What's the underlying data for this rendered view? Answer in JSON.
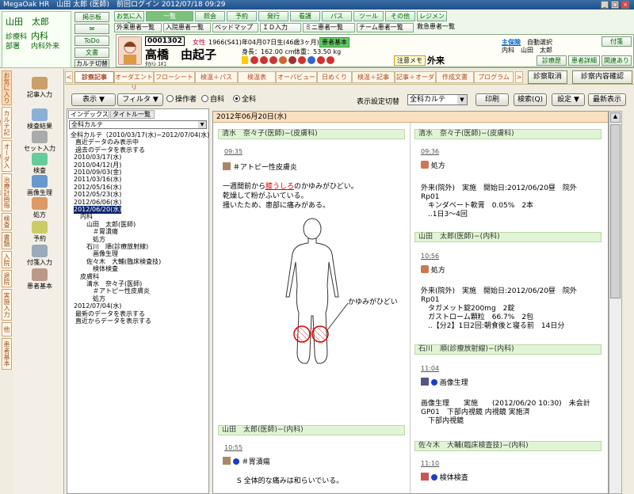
{
  "titlebar": {
    "text": "MegaOak HR　山田 太郎 (医師)　前回ログイン 2012/07/18 09:29",
    "buttons": [
      "_",
      "□",
      "×"
    ]
  },
  "user": {
    "name": "山田　太郎",
    "dept1": "診療科",
    "dept_val": "内科",
    "dept2": "部署",
    "dept2_val": "内科外来"
  },
  "header_buttons": {
    "notice": "掲示板",
    "mail": "✉",
    "todo": "ToDo",
    "doc": "文書",
    "chart_switch": "カルテ切替"
  },
  "main_tabs": [
    "お気に入り",
    "一覧",
    "照会",
    "予約",
    "発行",
    "看護",
    "パス",
    "ツール",
    "その他",
    "レジメン"
  ],
  "sub_tabs": [
    "外来患者一覧",
    "入院患者一覧",
    "ベッドマップ",
    "ＩＤ入力",
    "ミニ患者一覧",
    "チーム患者一覧",
    "救急患者一覧"
  ],
  "patient": {
    "id": "0001302",
    "sex_label": "女性",
    "birth": "1966(S41)年04月07日生(46歳3ヶ月)",
    "name": "高橋　由起子",
    "kana": "ﾀｶﾊｼ ﾕｷｺ",
    "height": "身長：162.00 cm",
    "weight": "体重：53.50 kg",
    "basic": "患者基本",
    "memo": "注意メモ",
    "status": "外来",
    "insurance_label": "主保険",
    "insurance_val": "自動選択",
    "doctor": "内科　山田　太郎",
    "note_btn": "付箋",
    "btns": [
      "診療歴",
      "患者詳細",
      "関連あり"
    ]
  },
  "vtabs": [
    "お気に入り",
    "カルテ記録",
    "オーダ入力",
    "治療計画指示",
    "検査",
    "書類",
    "入院",
    "退院",
    "実施入力",
    "他",
    "患者基本"
  ],
  "iconbar": [
    "記事入力",
    "検査結果",
    "セット入力",
    "検査",
    "画像生理",
    "処方",
    "予約",
    "付箋入力",
    "患者基本"
  ],
  "top_tabs": [
    "診察記事",
    "オーダエントリ",
    "フローシート",
    "検温＋パス",
    "検温表",
    "オーバビュー",
    "日めくり",
    "検温＋記事",
    "記事＋オーダ",
    "作成文書",
    "プログラム"
  ],
  "top_buttons": {
    "cancel": "診察取消",
    "confirm": "診察内容確認"
  },
  "toolbar": {
    "display": "表示",
    "filter": "フィルタ",
    "radio": [
      "操作者",
      "自科",
      "全科"
    ],
    "setting_label": "表示設定切替",
    "setting_val": "全科カルテ",
    "print": "印刷",
    "search": "検索(Q)",
    "settings": "設定",
    "latest": "最新表示"
  },
  "tree": {
    "tabs": [
      "インデックス",
      "タイトル一覧"
    ],
    "combo": "全科カルテ",
    "rows": [
      "全科カルテ（2010/03/17(水)−2012/07/04(水)",
      "直近データのみ表示中",
      "過去のデータを表示する",
      "2010/03/17(水)",
      "2010/04/12(月)",
      "2010/09/03(金)",
      "2011/03/16(水)",
      "2012/05/16(水)",
      "2012/05/23(水)",
      "2012/06/06(水)",
      "2012/06/20(水)",
      "内科",
      "山田　太郎(医師)",
      "＃胃潰瘍",
      "処方",
      "石川　順(診療放射線)",
      "画像生理",
      "佐々木　大輔(臨床検査技)",
      "検体検査",
      "皮膚科",
      "清水　奈々子(医師)",
      "＃アトピー性皮膚炎",
      "処方",
      "2012/07/04(水)",
      "最新のデータを表示する",
      "直近からデータを表示する"
    ]
  },
  "content": {
    "date_header": "2012年06月20日(水)",
    "left": {
      "head1": "清水　奈々子(医師)−(皮膚科)",
      "time1": "09:35",
      "problem": "＃アトピー性皮膚炎",
      "text1": "一週間前から",
      "text1_red": "膝うしろ",
      "text1_rest": "のかゆみがひどい。",
      "text2": "乾燥して粉がふいている。",
      "text3": "掻いたため、患部に痛みがある。",
      "body_note": "かゆみがひどい",
      "head2": "山田　太郎(医師)−(内科)",
      "time2": "10:55",
      "problem2": "＃胃潰瘍",
      "text4": "S 全体的な痛みは和らいでいる。"
    },
    "right": {
      "head1": "清水　奈々子(医師)−(皮膚科)",
      "time1": "09:36",
      "rx": "処方",
      "rx_l1": "外来(院外)　実施　開始日:2012/06/20昼　院外",
      "rx_l2": "Rp01",
      "rx_l3": "　キンダベート軟膏　0.05%　2本",
      "rx_l4": "　..1日3〜4回",
      "head2": "山田　太郎(医師)−(内科)",
      "time2": "10:56",
      "rx2": "処方",
      "rx2_l1": "外来(院外)　実施　開始日:2012/06/20昼　院外",
      "rx2_l2": "Rp01",
      "rx2_l3": "　タガメット錠200mg　2錠",
      "rx2_l4": "　ガストローム顆粒　66.7%　2包",
      "rx2_l5": "　..【分2】1日2回:朝食後と寝る前　14日分",
      "head3": "石川　順(診療放射線)−(内科)",
      "time3": "11:04",
      "img": "画像生理",
      "img_l1": "画像生理　　実施　　(2012/06/20 10:30)　未会計",
      "img_l2": "GP01　下部内視鏡 内視鏡 実施済",
      "img_l3": "　下部内視鏡",
      "head4": "佐々木　大輔(臨床検査技)−(内科)",
      "time4": "11:10",
      "lab": "検体検査"
    }
  }
}
